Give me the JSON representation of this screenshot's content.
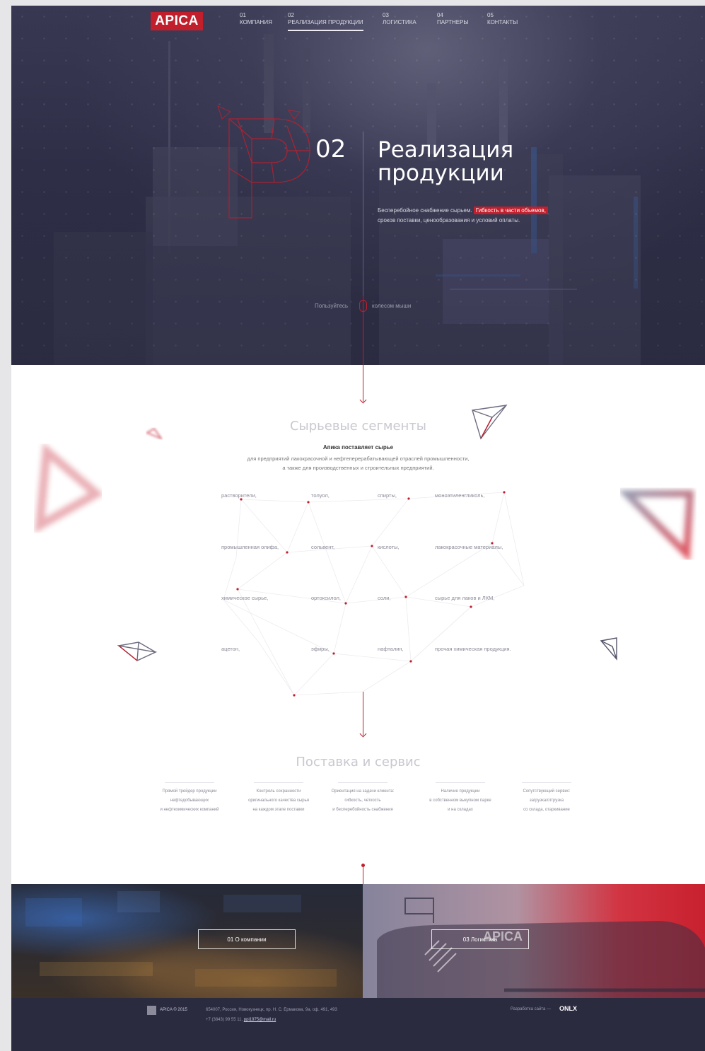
{
  "header": {
    "logo": "APICA",
    "nav": [
      {
        "num": "01",
        "label": "КОМПАНИЯ"
      },
      {
        "num": "02",
        "label": "РЕАЛИЗАЦИЯ ПРОДУКЦИИ"
      },
      {
        "num": "03",
        "label": "ЛОГИСТИКА"
      },
      {
        "num": "04",
        "label": "ПАРТНЕРЫ"
      },
      {
        "num": "05",
        "label": "КОНТАКТЫ"
      }
    ]
  },
  "hero": {
    "number": "02",
    "title_line1": "Реализация",
    "title_line2": "продукции",
    "lead_part1": "Бесперебойное снабжение сырьем. ",
    "lead_highlight": "Гибкость в части объемов,",
    "lead_part2": "сроков поставки, ценообразования и условий оплаты.",
    "scroll_left": "Пользуйтесь",
    "scroll_right": "колесом мыши"
  },
  "segments": {
    "title": "Сырьевые сегменты",
    "subtitle": "Апика поставляет сырье",
    "text_line1": "для предприятий лакокрасочной и нефтеперерабатывающей отраслей промышленности,",
    "text_line2": "а также для производственных и строительных предприятий.",
    "items": [
      "растворители,",
      "толуол,",
      "спирты,",
      "моноэтиленгликоль,",
      "промышленная олифа,",
      "сольвент,",
      "кислоты,",
      "лакокрасочные материалы,",
      "химическое сырье,",
      "ортоксилол,",
      "соли,",
      "сырье для лаков и ЛКМ,",
      "ацетон,",
      "эфиры,",
      "нафталин,",
      "прочая химическая  продукция."
    ]
  },
  "service": {
    "title": "Поставка и сервис",
    "items": [
      {
        "l1": "Прямой трейдер продукции",
        "l2": "нефтедобывающих",
        "l3": "и нефтехимических компаний"
      },
      {
        "l1": "Контроль сохранности",
        "l2": "оригинального качества сырья",
        "l3": "на каждом этапе поставки"
      },
      {
        "l1": "Ориентация на задачи клиента:",
        "l2": "гибкость, четкость",
        "l3": "и бесперебойность снабжения"
      },
      {
        "l1": "Наличие продукции",
        "l2": "в собственном выкупном парке",
        "l3": "и на складах"
      },
      {
        "l1": "Сопутствующий сервис:",
        "l2": "загрузка/отгрузка",
        "l3": "со склада, отаркивание"
      }
    ]
  },
  "panels": {
    "left_button": "01   О компании",
    "right_button": "03   Логистика"
  },
  "footer": {
    "copyright": "APICA © 2015",
    "address": "654007, Россия, Новокузнецк, пр. Н. С. Ермакова, 9а, оф. 491, 493",
    "phone": "+7 (3843) 99 55 11, ",
    "email": "ppi1975@mail.ru",
    "dev_label": "Разработка сайта — ",
    "dev_name": "ONLX"
  },
  "colors": {
    "accent": "#c21f2d",
    "dark": "#2b2b40"
  }
}
